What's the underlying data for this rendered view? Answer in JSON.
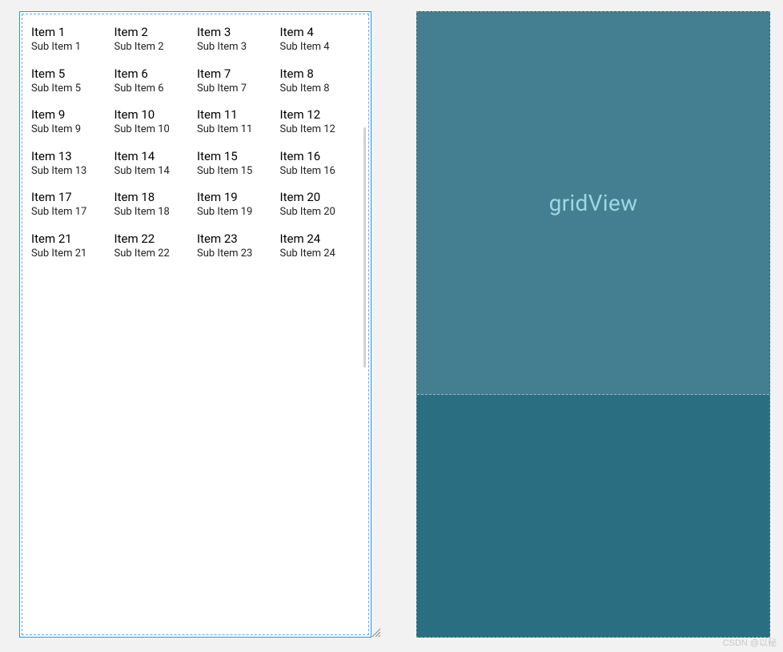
{
  "grid": {
    "columns": 4,
    "items": [
      {
        "title": "Item 1",
        "sub": "Sub Item 1"
      },
      {
        "title": "Item 2",
        "sub": "Sub Item 2"
      },
      {
        "title": "Item 3",
        "sub": "Sub Item 3"
      },
      {
        "title": "Item 4",
        "sub": "Sub Item 4"
      },
      {
        "title": "Item 5",
        "sub": "Sub Item 5"
      },
      {
        "title": "Item 6",
        "sub": "Sub Item 6"
      },
      {
        "title": "Item 7",
        "sub": "Sub Item 7"
      },
      {
        "title": "Item 8",
        "sub": "Sub Item 8"
      },
      {
        "title": "Item 9",
        "sub": "Sub Item 9"
      },
      {
        "title": "Item 10",
        "sub": "Sub Item 10"
      },
      {
        "title": "Item 11",
        "sub": "Sub Item 11"
      },
      {
        "title": "Item 12",
        "sub": "Sub Item 12"
      },
      {
        "title": "Item 13",
        "sub": "Sub Item 13"
      },
      {
        "title": "Item 14",
        "sub": "Sub Item 14"
      },
      {
        "title": "Item 15",
        "sub": "Sub Item 15"
      },
      {
        "title": "Item 16",
        "sub": "Sub Item 16"
      },
      {
        "title": "Item 17",
        "sub": "Sub Item 17"
      },
      {
        "title": "Item 18",
        "sub": "Sub Item 18"
      },
      {
        "title": "Item 19",
        "sub": "Sub Item 19"
      },
      {
        "title": "Item 20",
        "sub": "Sub Item 20"
      },
      {
        "title": "Item 21",
        "sub": "Sub Item 21"
      },
      {
        "title": "Item 22",
        "sub": "Sub Item 22"
      },
      {
        "title": "Item 23",
        "sub": "Sub Item 23"
      },
      {
        "title": "Item 24",
        "sub": "Sub Item 24"
      }
    ]
  },
  "blueprint": {
    "widget_label": "gridView"
  },
  "watermark": "CSDN @以秘"
}
